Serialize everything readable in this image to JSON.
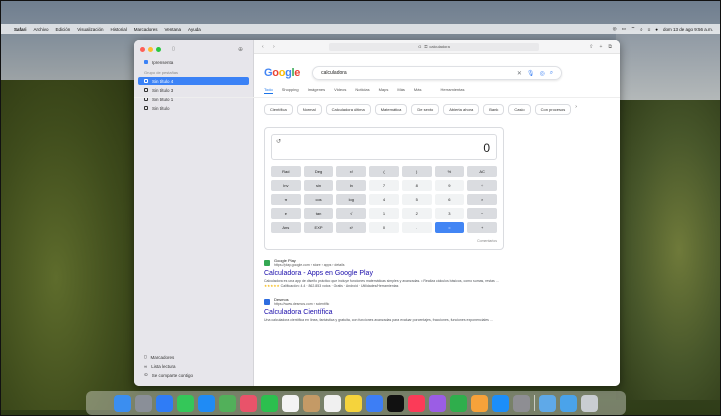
{
  "menubar": {
    "items": [
      "Safari",
      "Archivo",
      "Edición",
      "Visualización",
      "Historial",
      "Marcadores",
      "Ventana",
      "Ayuda"
    ],
    "datetime": "dom 13 de ago 9:56 a.m."
  },
  "sidebar": {
    "top_item": "Iprensenta",
    "section_label": "Grupo de pestañas",
    "tab_groups": [
      "Sin título 4",
      "Sin título 3",
      "Sin título 1",
      "Sin título"
    ],
    "bottom_items": [
      "Marcadores",
      "Lista lectura",
      "Se comparte contigo"
    ]
  },
  "toolbar": {
    "address": "calculadora"
  },
  "google": {
    "logo": "Google",
    "query": "calculadora",
    "tabs": [
      "Todo",
      "Shopping",
      "Imágenes",
      "Videos",
      "Noticias",
      "Maps",
      "Más",
      "Más",
      "Herramientas"
    ],
    "chips": [
      "Científica",
      "Normal",
      "Calculadora última",
      "Matemática",
      "De sexto",
      "Abierta ahora",
      "Bank",
      "Casio",
      "Con procesos"
    ]
  },
  "calculator": {
    "display": "0",
    "keys": [
      [
        "Rad",
        "Deg",
        "x!",
        "(",
        ")",
        "%",
        "AC"
      ],
      [
        "Inv",
        "sin",
        "ln",
        "7",
        "8",
        "9",
        "÷"
      ],
      [
        "π",
        "cos",
        "log",
        "4",
        "5",
        "6",
        "×"
      ],
      [
        "e",
        "tan",
        "√",
        "1",
        "2",
        "3",
        "−"
      ],
      [
        "Ans",
        "EXP",
        "xʸ",
        "0",
        ".",
        "=",
        "+"
      ]
    ],
    "more_info": "Comentarios"
  },
  "results": [
    {
      "site": "Google Play",
      "url": "https://play.google.com › store › apps › details",
      "title": "Calculadora - Apps en Google Play",
      "snippet": "Calculadora es una app de diseño práctico que incluye funciones matemáticas simples y avanzadas. • Realiza cálculos básicos, como sumas, restas ...",
      "rating": "Calificación: 4.4 · 862.853 votos · Gratis · Android · Utilidades/Herramientas"
    },
    {
      "site": "Desmos",
      "url": "https://www.desmos.com › scientific",
      "title": "Calculadora Científica",
      "snippet": "Una calculadora científica en línea, fantástica y gratuita, con funciones avanzadas para evaluar porcentajes, fracciones, funciones exponenciales ..."
    }
  ],
  "dock": {
    "icons": [
      {
        "name": "finder",
        "color": "#3b8ef0"
      },
      {
        "name": "launchpad",
        "color": "#8a8f98"
      },
      {
        "name": "safari",
        "color": "#2f7cf6"
      },
      {
        "name": "messages",
        "color": "#34c759"
      },
      {
        "name": "mail",
        "color": "#1f8bf5"
      },
      {
        "name": "maps",
        "color": "#52b05a"
      },
      {
        "name": "photos",
        "color": "#e9536a"
      },
      {
        "name": "facetime",
        "color": "#2cbf4e"
      },
      {
        "name": "calendar",
        "color": "#f4f4f4"
      },
      {
        "name": "contacts",
        "color": "#c49a66"
      },
      {
        "name": "reminders",
        "color": "#f0f0f0"
      },
      {
        "name": "notes",
        "color": "#f5d33c"
      },
      {
        "name": "freeform",
        "color": "#3d7ef5"
      },
      {
        "name": "tv",
        "color": "#111111"
      },
      {
        "name": "music",
        "color": "#fb3b58"
      },
      {
        "name": "podcasts",
        "color": "#9b5de5"
      },
      {
        "name": "numbers",
        "color": "#2fae4c"
      },
      {
        "name": "pages",
        "color": "#f6a23a"
      },
      {
        "name": "app-store",
        "color": "#1c8ef9"
      },
      {
        "name": "system-settings",
        "color": "#8e8e93"
      },
      {
        "name": "preview",
        "color": "#5fa9e8"
      },
      {
        "name": "downloads",
        "color": "#4aa3ea"
      },
      {
        "name": "trash",
        "color": "#c9cdd2"
      }
    ]
  }
}
